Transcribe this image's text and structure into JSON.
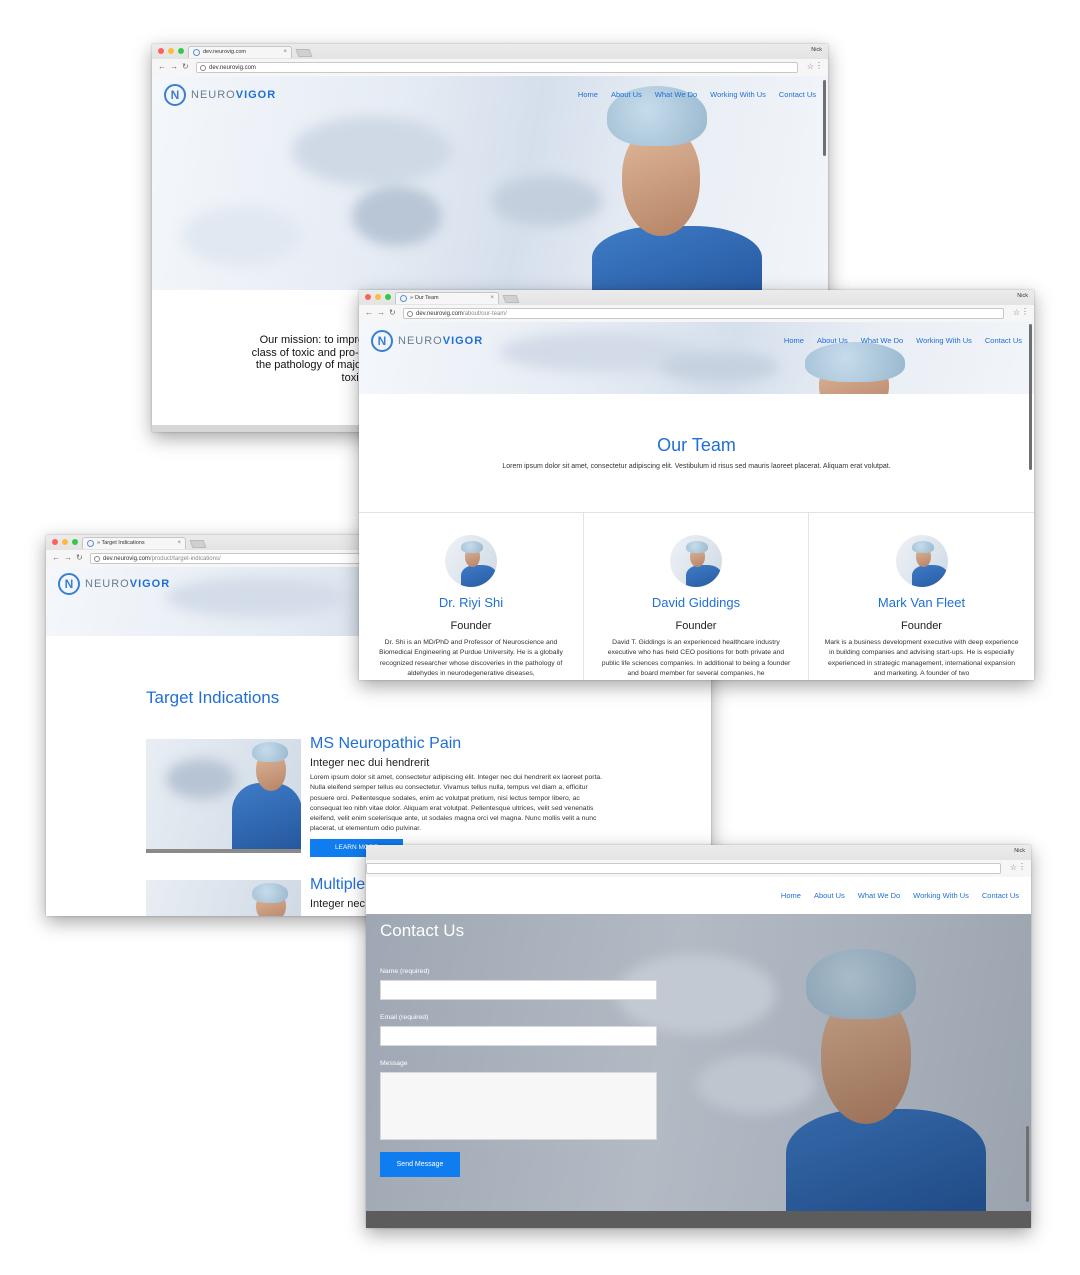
{
  "user": "Nick",
  "windows": {
    "home": {
      "tab_title": "dev.neurovig.com",
      "url_main": "dev.neurovig.com",
      "url_path": "",
      "mission": "Our mission: to improve th\nclass of toxic and pro-inflam\nthe pathology of major dise\ntoxic alde"
    },
    "team": {
      "tab_title": "» Our Team",
      "url_main": "dev.neurovig.com",
      "url_path": "/about/our-team/",
      "title": "Our Team",
      "subtitle": "Lorem ipsum dolor sit amet, consectetur adipiscing elit. Vestibulum id risus sed mauris laoreet placerat. Aliquam erat volutpat.",
      "members": [
        {
          "name": "Dr. Riyi Shi",
          "role": "Founder",
          "bio": "Dr. Shi is an MD/PhD and Professor of Neuroscience and Biomedical Engineering at Purdue University. He is a globally recognized researcher whose discoveries in the pathology of aldehydes in neurodegenerative diseases,"
        },
        {
          "name": "David Giddings",
          "role": "Founder",
          "bio": "David T. Giddings is an experienced healthcare industry executive who has held CEO positions for both private and public life sciences companies. In additional to being a founder and board member for several companies, he"
        },
        {
          "name": "Mark Van Fleet",
          "role": "Founder",
          "bio": "Mark is a business development executive with deep experience in building companies and advising start-ups. He is especially experienced in strategic management, international expansion and marketing. A founder of two"
        }
      ]
    },
    "targets": {
      "tab_title": "» Target Indications",
      "url_main": "dev.neurovig.com",
      "url_path": "/product/target-indications/",
      "title": "Target Indications",
      "items": [
        {
          "heading": "MS Neuropathic Pain",
          "sub": "Integer nec dui hendrerit",
          "body": "Lorem ipsum dolor sit amet, consectetur adipiscing elit. Integer nec dui hendrerit ex laoreet porta. Nulla eleifend semper tellus eu consectetur. Vivamus tellus nulla, tempus vel diam a, efficitur posuere orci. Pellentesque sodales, enim ac volutpat pretium, nisi lectus tempor libero, ac consequat leo nibh vitae dolor. Aliquam erat volutpat. Pellentesque ultrices, velit sed venenatis eleifend, velit enim scelerisque ante, ut sodales magna orci vel magna. Nunc mollis velit a nunc placerat, ut elementum odio pulvinar.",
          "button": "LEARN MORE"
        },
        {
          "heading": "Multiple Sclerosis",
          "sub": "Integer nec dui hendrerit"
        }
      ]
    },
    "contact": {
      "title": "Contact Us",
      "name_label": "Name (required)",
      "email_label": "Email (required)",
      "message_label": "Message",
      "send": "Send Message"
    }
  },
  "logo": {
    "letter": "N",
    "part1": "NEURO",
    "part2": "VIGOR"
  },
  "nav": [
    "Home",
    "About Us",
    "What We Do",
    "Working With Us",
    "Contact Us"
  ],
  "colors": {
    "brand_blue": "#1f6fd6",
    "button_blue": "#0f7cf0"
  }
}
